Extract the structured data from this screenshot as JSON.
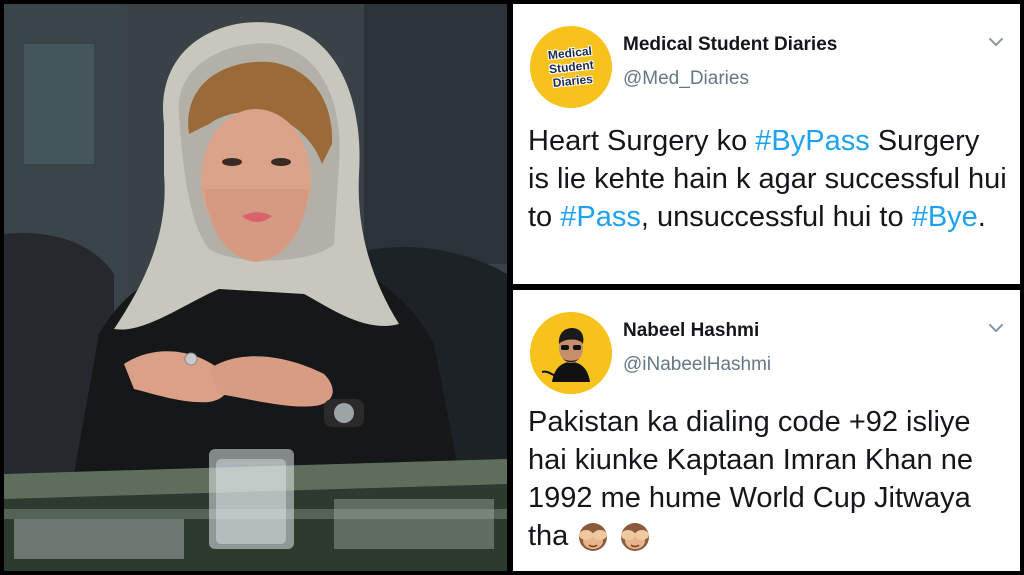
{
  "tweets": [
    {
      "display_name": "Medical Student Diaries",
      "handle": "@Med_Diaries",
      "avatar_text": [
        "Medical",
        "Student",
        "Diaries"
      ],
      "text": {
        "p1": "Heart Surgery ko ",
        "tag1": "#ByPass",
        "p2": " Surgery is lie kehte hain k agar successful hui to ",
        "tag2": "#Pass",
        "p3": ", unsuccessful hui to ",
        "tag3": "#Bye",
        "p4": "."
      }
    },
    {
      "display_name": "Nabeel Hashmi",
      "handle": "@iNabeelHashmi",
      "text": "Pakistan ka dialing code +92 isliye hai kiunke Kaptaan Imran Khan ne 1992 me hume World Cup Jitwaya tha",
      "emojis": [
        "see-no-evil-monkey",
        "see-no-evil-monkey"
      ]
    }
  ],
  "colors": {
    "hashtag": "#1da1f2",
    "name": "#14171a",
    "handle": "#657786",
    "avatar_bg": "#f6c21b"
  },
  "icons": {
    "chevron": "chevron-down-icon"
  }
}
